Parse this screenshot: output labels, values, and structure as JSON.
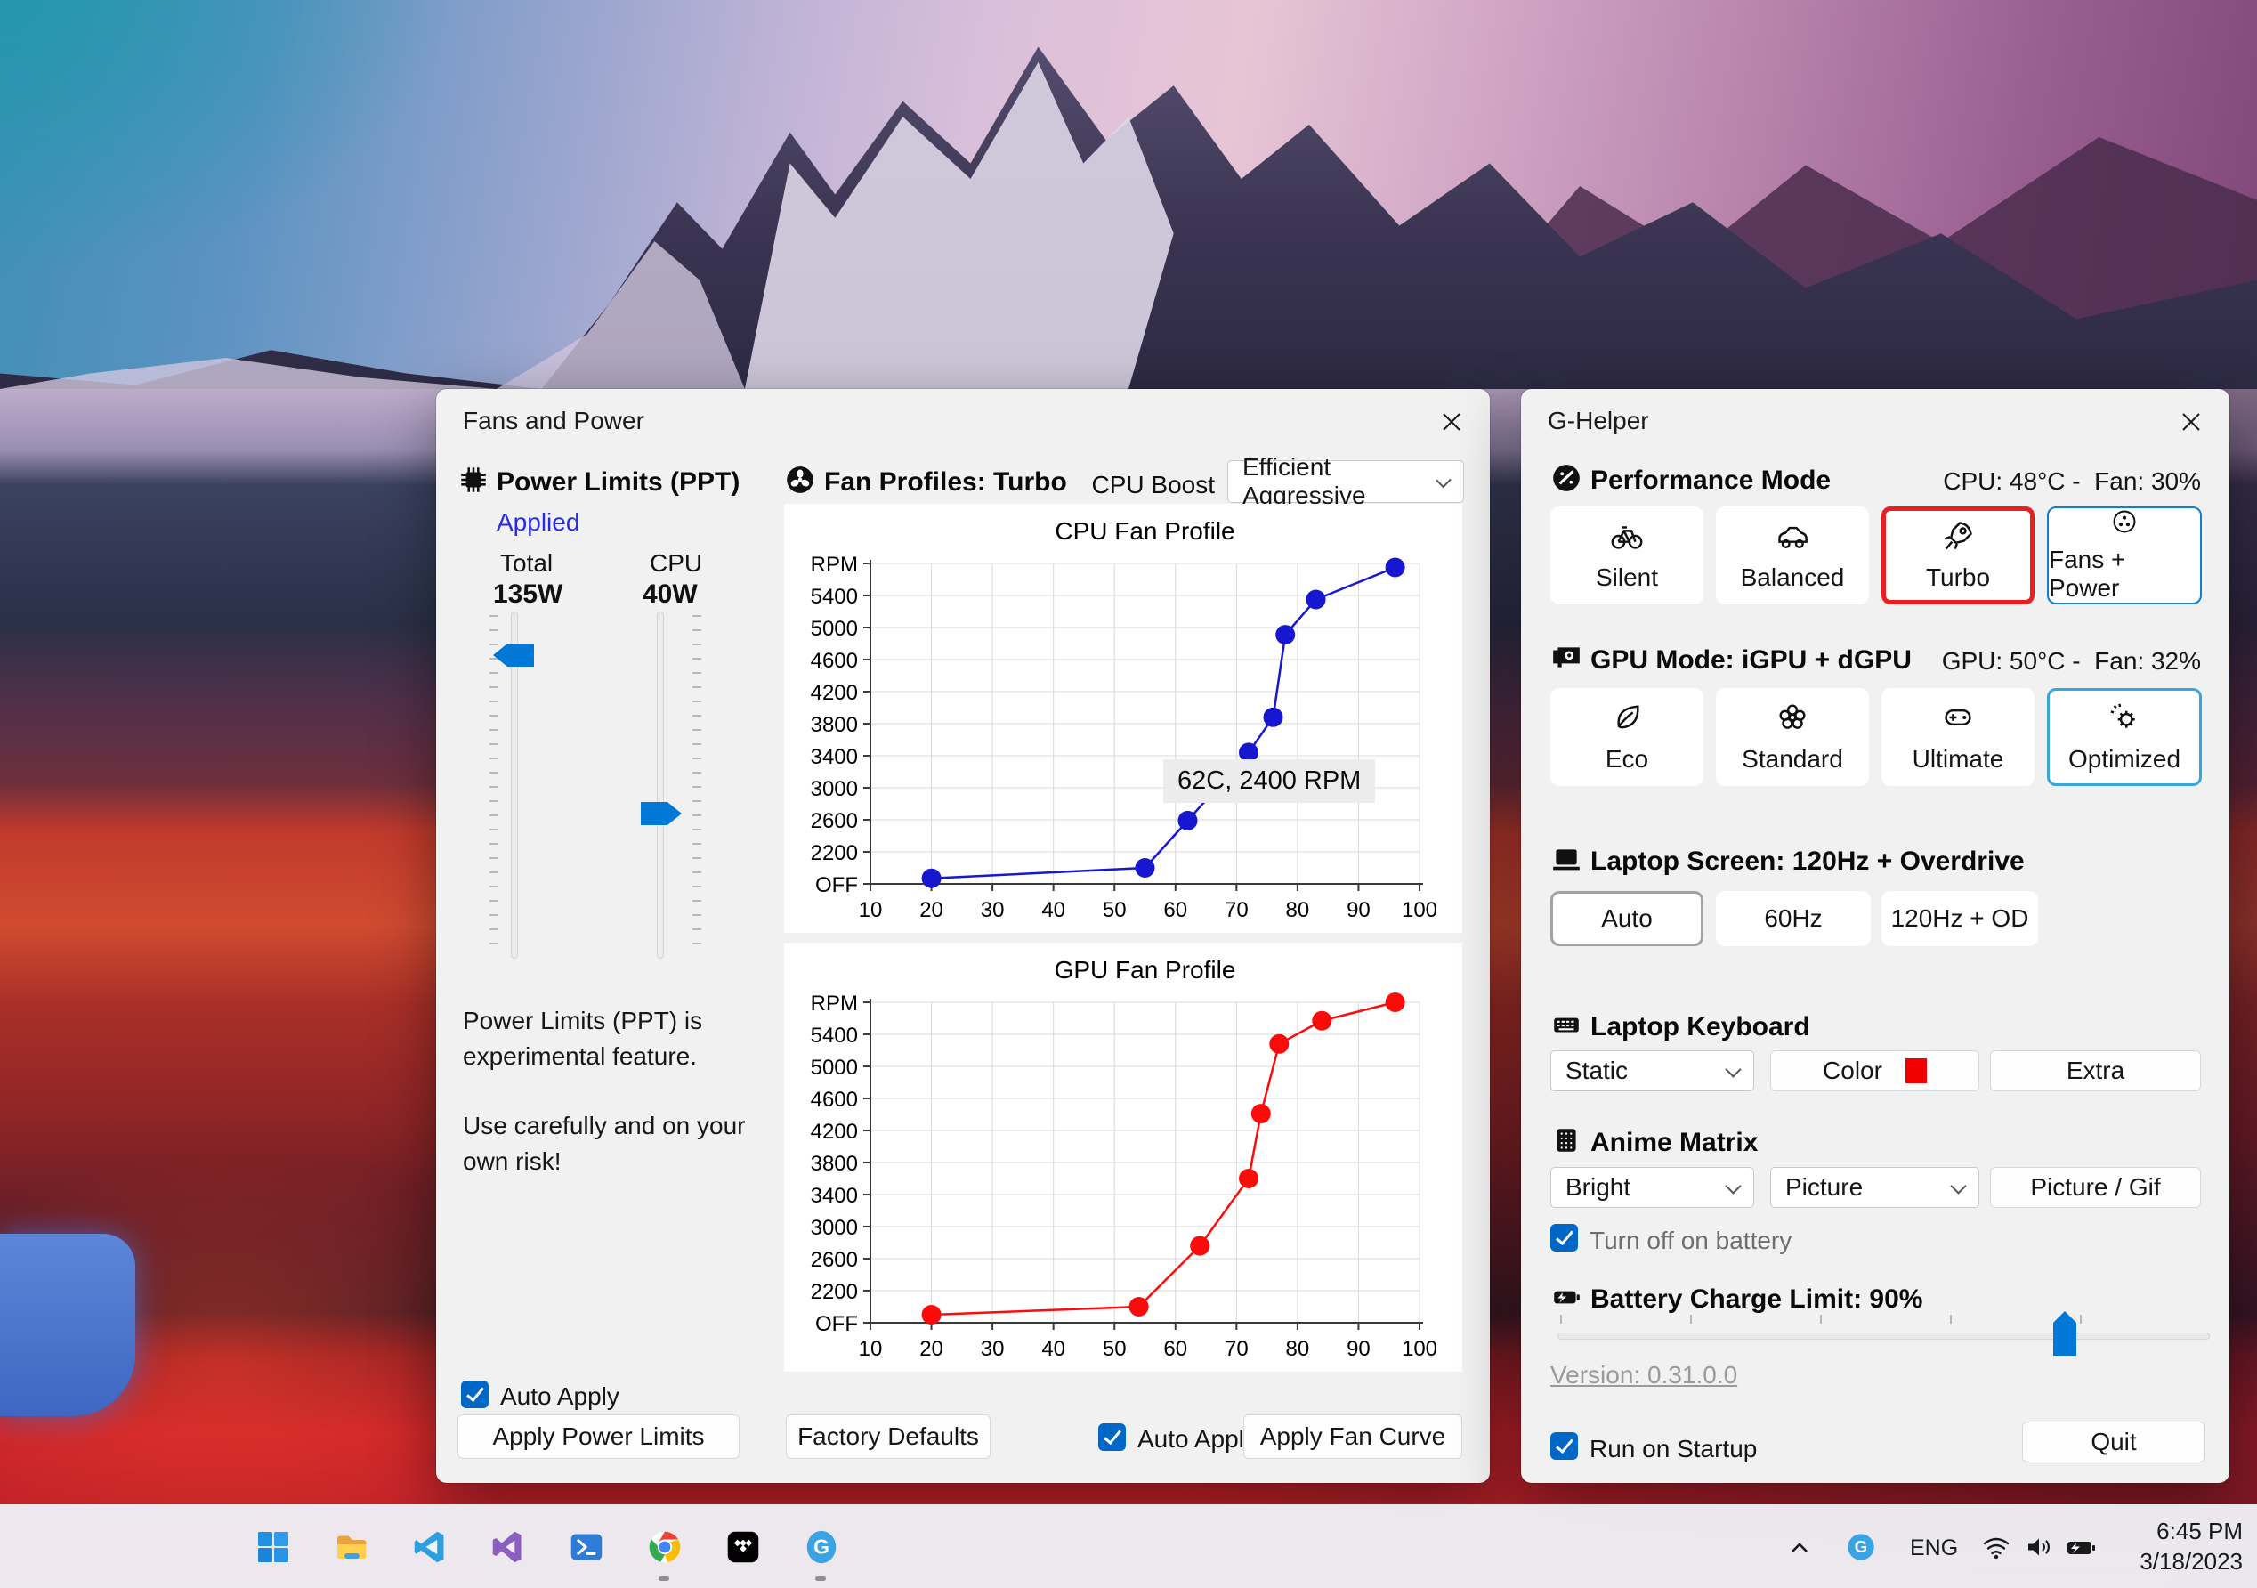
{
  "fans_window": {
    "title": "Fans and Power",
    "power_limits": {
      "heading": "Power Limits (PPT)",
      "status": "Applied",
      "total_label": "Total",
      "total_value": "135W",
      "cpu_label": "CPU",
      "cpu_value": "40W",
      "note1": "Power Limits (PPT) is experimental feature.",
      "note2": "Use carefully and on your own risk!",
      "auto_apply_label": "Auto Apply",
      "auto_apply_checked": true,
      "apply_button": "Apply Power Limits"
    },
    "fan_profiles": {
      "heading": "Fan Profiles: Turbo",
      "cpu_boost_label": "CPU Boost",
      "cpu_boost_value": "Efficient Aggressive",
      "factory_defaults_button": "Factory Defaults",
      "auto_apply_label": "Auto Apply",
      "auto_apply_checked": true,
      "apply_fan_curve_button": "Apply Fan Curve"
    }
  },
  "chart_data": [
    {
      "type": "line",
      "title": "CPU Fan Profile",
      "xlim": [
        10,
        100
      ],
      "xstep": 10,
      "ylim": [
        1800,
        5800
      ],
      "ystep": 400,
      "grid": true,
      "legend": "none",
      "xtick_labels": [
        "10",
        "20",
        "30",
        "40",
        "50",
        "60",
        "70",
        "80",
        "90",
        "100"
      ],
      "ytick_labels": [
        "OFF",
        "2200",
        "2600",
        "3000",
        "3400",
        "3800",
        "4200",
        "4600",
        "5000",
        "5400",
        "RPM"
      ],
      "series": [
        {
          "name": "CPU fan curve",
          "color": "#1717cf",
          "points": [
            [
              20,
              1870
            ],
            [
              55,
              2000
            ],
            [
              62,
              2590
            ],
            [
              72,
              3440
            ],
            [
              76,
              3880
            ],
            [
              78,
              4910
            ],
            [
              83,
              5350
            ],
            [
              96,
              5750
            ]
          ]
        }
      ],
      "tooltip": "62C, 2400 RPM"
    },
    {
      "type": "line",
      "title": "GPU Fan Profile",
      "xlim": [
        10,
        100
      ],
      "xstep": 10,
      "ylim": [
        1800,
        5800
      ],
      "ystep": 400,
      "grid": true,
      "legend": "none",
      "xtick_labels": [
        "10",
        "20",
        "30",
        "40",
        "50",
        "60",
        "70",
        "80",
        "90",
        "100"
      ],
      "ytick_labels": [
        "OFF",
        "2200",
        "2600",
        "3000",
        "3400",
        "3800",
        "4200",
        "4600",
        "5000",
        "5400",
        "RPM"
      ],
      "series": [
        {
          "name": "GPU fan curve",
          "color": "#fd0b0b",
          "points": [
            [
              20,
              1900
            ],
            [
              54,
              2000
            ],
            [
              64,
              2760
            ],
            [
              72,
              3600
            ],
            [
              74,
              4410
            ],
            [
              77,
              5280
            ],
            [
              84,
              5570
            ],
            [
              96,
              5800
            ]
          ]
        }
      ]
    }
  ],
  "ghelper_window": {
    "title": "G-Helper",
    "performance": {
      "heading": "Performance Mode",
      "status": "CPU: 48°C -  Fan: 30%",
      "selected": "Turbo",
      "modes": [
        {
          "label": "Silent"
        },
        {
          "label": "Balanced"
        },
        {
          "label": "Turbo"
        },
        {
          "label": "Fans + Power"
        }
      ]
    },
    "gpu": {
      "heading": "GPU Mode: iGPU + dGPU",
      "status": "GPU: 50°C -  Fan: 32%",
      "selected": "Optimized",
      "modes": [
        {
          "label": "Eco"
        },
        {
          "label": "Standard"
        },
        {
          "label": "Ultimate"
        },
        {
          "label": "Optimized"
        }
      ]
    },
    "screen": {
      "heading": "Laptop Screen: 120Hz + Overdrive",
      "selected": "Auto",
      "options": [
        {
          "label": "Auto"
        },
        {
          "label": "60Hz"
        },
        {
          "label": "120Hz + OD"
        }
      ]
    },
    "keyboard": {
      "heading": "Laptop Keyboard",
      "mode_value": "Static",
      "color_button": "Color",
      "color_swatch": "#f20000",
      "extra_button": "Extra"
    },
    "anime_matrix": {
      "heading": "Anime Matrix",
      "brightness_value": "Bright",
      "mode_value": "Picture",
      "picture_gif_button": "Picture / Gif",
      "turn_off_label": "Turn off on battery",
      "turn_off_checked": true
    },
    "battery": {
      "heading": "Battery Charge Limit: 90%",
      "value_percent": 90
    },
    "version_link": "Version: 0.31.0.0",
    "run_on_startup_label": "Run on Startup",
    "run_on_startup_checked": true,
    "quit_button": "Quit"
  },
  "taskbar": {
    "accent_color": "#0078d4",
    "icons": [
      "windows-start",
      "file-explorer",
      "vscode",
      "visual-studio",
      "powershell",
      "chrome",
      "tidal",
      "g-helper"
    ],
    "tray": {
      "language": "ENG",
      "time": "6:45 PM",
      "date": "3/18/2023"
    }
  }
}
